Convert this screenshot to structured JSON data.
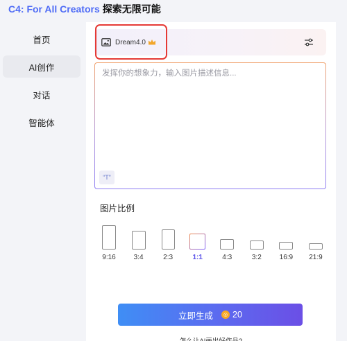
{
  "header": {
    "brand": "C4: For All Creators",
    "slogan": "探索无限可能"
  },
  "sidebar": {
    "items": [
      {
        "label": "首页",
        "active": false
      },
      {
        "label": "AI创作",
        "active": true
      },
      {
        "label": "对话",
        "active": false
      },
      {
        "label": "智能体",
        "active": false
      }
    ]
  },
  "model_selector": {
    "icon": "image-icon",
    "name": "Dream4.0",
    "badge_icon": "crown-icon",
    "settings_icon": "settings-sliders-icon"
  },
  "prompt": {
    "placeholder": "发挥你的想象力，输入图片描述信息...",
    "value": "",
    "quote_button": "“T”"
  },
  "aspect_ratio": {
    "title": "图片比例",
    "selected": "1:1",
    "options": [
      "9:16",
      "3:4",
      "2:3",
      "1:1",
      "4:3",
      "3:2",
      "16:9",
      "21:9"
    ]
  },
  "generate": {
    "label": "立即生成",
    "cost": "20",
    "coin_icon": "coin-icon"
  },
  "help_link": "怎么让AI画出好作品?",
  "colors": {
    "brand": "#4f6cf6",
    "highlight": "#e53935",
    "selected_ratio": "#5a52e8",
    "crown": "#f2a72b"
  }
}
